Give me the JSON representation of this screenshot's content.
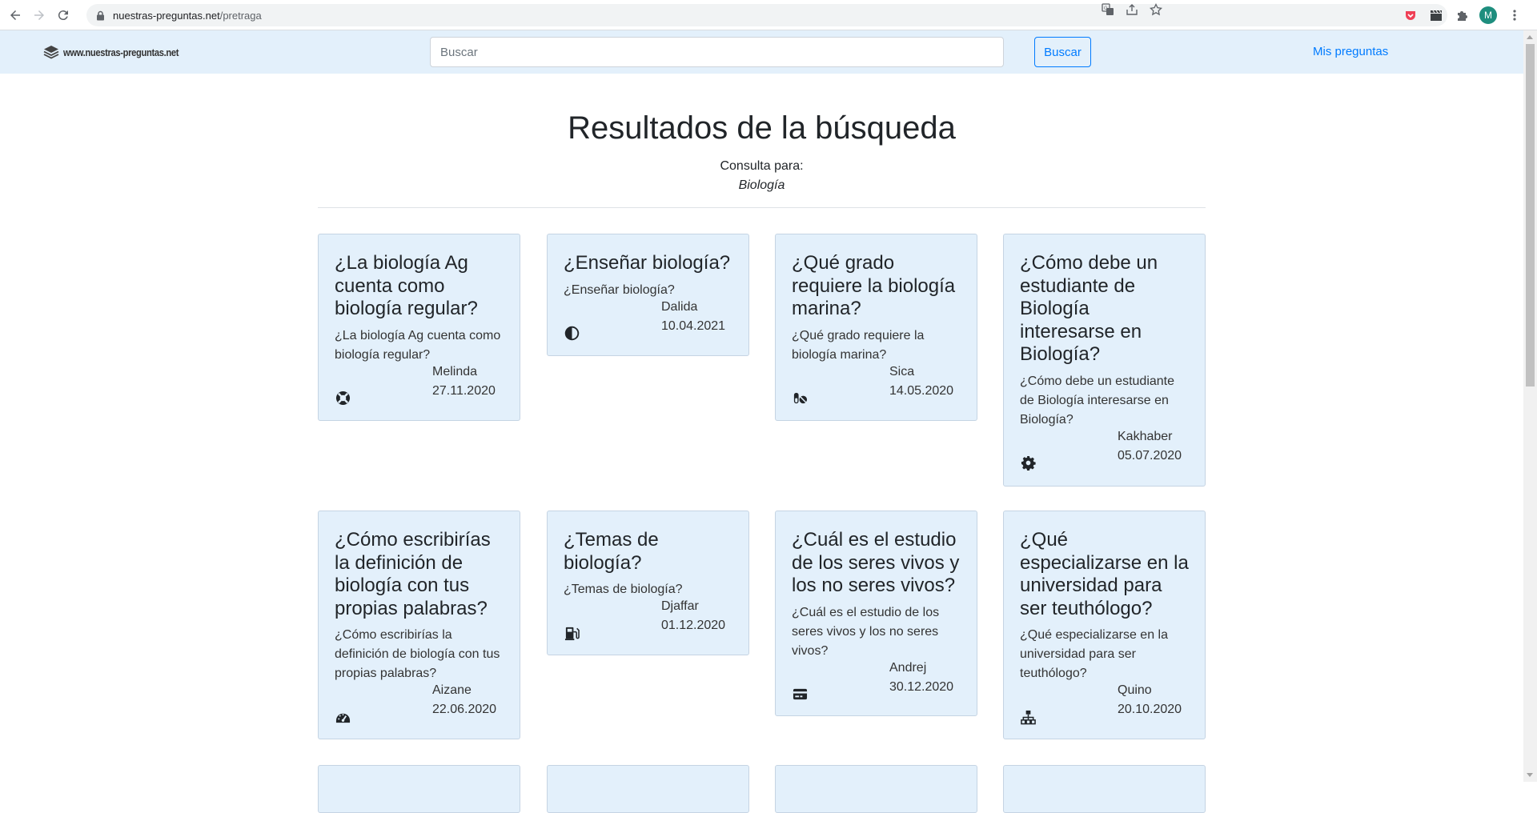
{
  "browser": {
    "url_host": "nuestras-preguntas.net",
    "url_path": "/pretraga",
    "avatar_letter": "M"
  },
  "header": {
    "logo_text": "www.nuestras-preguntas.net",
    "search_placeholder": "Buscar",
    "search_button": "Buscar",
    "my_questions_link": "Mis preguntas"
  },
  "main": {
    "title": "Resultados de la búsqueda",
    "query_label": "Consulta para:",
    "query_value": "Biología"
  },
  "cards": [
    {
      "title": "¿La biología Ag cuenta como biología regular?",
      "text": "¿La biología Ag cuenta como biología regular?",
      "author": "Melinda",
      "date": "27.11.2020",
      "icon": "life-ring-icon"
    },
    {
      "title": "¿Enseñar biología?",
      "text": "¿Enseñar biología?",
      "author": "Dalida",
      "date": "10.04.2021",
      "icon": "adjust-icon"
    },
    {
      "title": "¿Qué grado requiere la biología marina?",
      "text": "¿Qué grado requiere la biología marina?",
      "author": "Sica",
      "date": "14.05.2020",
      "icon": "pills-icon"
    },
    {
      "title": "¿Cómo debe un estudiante de Biología interesarse en Biología?",
      "text": "¿Cómo debe un estudiante de Biología interesarse en Biología?",
      "author": "Kakhaber",
      "date": "05.07.2020",
      "icon": "gear-icon"
    },
    {
      "title": "¿Cómo escribirías la definición de biología con tus propias palabras?",
      "text": "¿Cómo escribirías la definición de biología con tus propias palabras?",
      "author": "Aizane",
      "date": "22.06.2020",
      "icon": "tachometer-icon"
    },
    {
      "title": "¿Temas de biología?",
      "text": "¿Temas de biología?",
      "author": "Djaffar",
      "date": "01.12.2020",
      "icon": "gas-pump-icon"
    },
    {
      "title": "¿Cuál es el estudio de los seres vivos y los no seres vivos?",
      "text": "¿Cuál es el estudio de los seres vivos y los no seres vivos?",
      "author": "Andrej",
      "date": "30.12.2020",
      "icon": "credit-card-icon"
    },
    {
      "title": "¿Qué especializarse en la universidad para ser teuthólogo?",
      "text": "¿Qué especializarse en la universidad para ser teuthólogo?",
      "author": "Quino",
      "date": "20.10.2020",
      "icon": "sitemap-icon"
    }
  ]
}
